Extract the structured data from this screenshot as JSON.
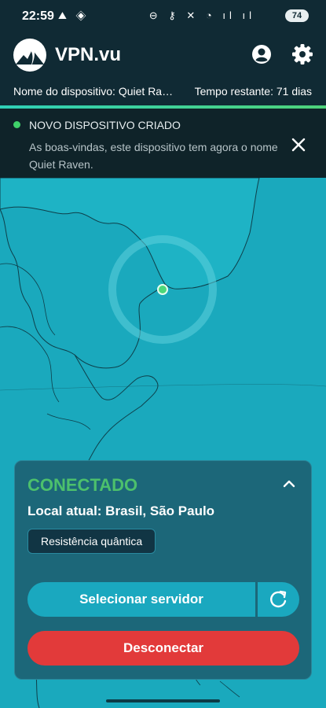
{
  "status_bar": {
    "time": "22:59",
    "battery": "74",
    "left_icons": [
      "notification-icon",
      "alert-icon"
    ],
    "right_icons": [
      "dnd-icon",
      "key-icon",
      "mute-icon",
      "wifi-icon",
      "signal-icon",
      "signal-icon"
    ]
  },
  "header": {
    "brand": "VPN.vu",
    "device_name": "Nome do dispositivo: Quiet Raven",
    "time_remaining": "Tempo restante: 71 dias"
  },
  "notice": {
    "title": "NOVO DISPOSITIVO CRIADO",
    "text": "As boas-vindas, este dispositivo tem agora o nome Quiet Raven."
  },
  "connection": {
    "status": "CONECTADO",
    "location": "Local atual: Brasil, São Paulo",
    "badge": "Resistência quântica",
    "select_server": "Selecionar servidor",
    "disconnect": "Desconectar"
  },
  "colors": {
    "accent": "#1aa8bf",
    "connected": "#4cc06c",
    "danger": "#e23a3a",
    "map_water": "#1aa9bd",
    "header_bg": "#102a34"
  }
}
